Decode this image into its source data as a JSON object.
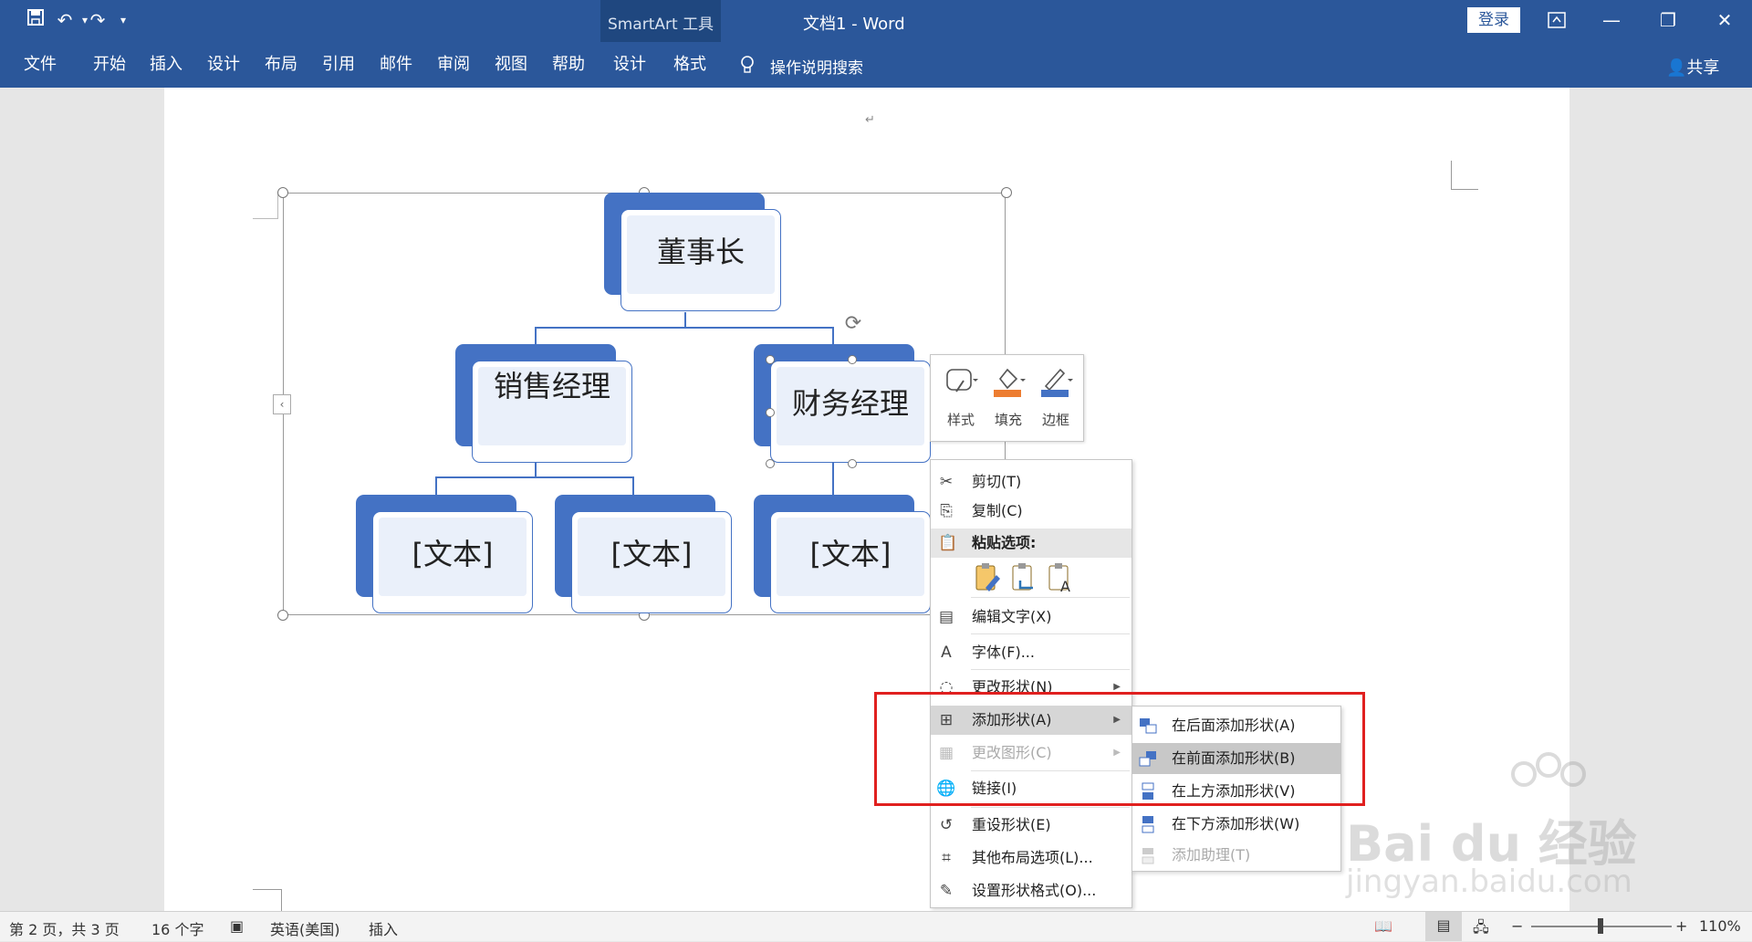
{
  "titlebar": {
    "context_tools": "SmartArt 工具",
    "doc_title": "文档1  -  Word",
    "login": "登录",
    "qat": {
      "save": "💾",
      "undo": "↶",
      "redo": "↷",
      "more": "▾"
    }
  },
  "ribbon": {
    "tabs": [
      "文件",
      "开始",
      "插入",
      "设计",
      "布局",
      "引用",
      "邮件",
      "审阅",
      "视图",
      "帮助",
      "设计",
      "格式"
    ],
    "tell_me": "操作说明搜索",
    "share": "共享"
  },
  "smartart": {
    "top": "董事长",
    "mid_left": "销售经理",
    "mid_right": "财务经理",
    "bottom": [
      "[文本]",
      "[文本]",
      "[文本]"
    ]
  },
  "mini_toolbar": {
    "style": "样式",
    "fill": "填充",
    "border": "边框"
  },
  "context_menu": {
    "cut": "剪切(T)",
    "copy": "复制(C)",
    "paste_options": "粘贴选项:",
    "edit_text": "编辑文字(X)",
    "font": "字体(F)...",
    "change_shape": "更改形状(N)",
    "add_shape": "添加形状(A)",
    "change_graphic": "更改图形(C)",
    "link": "链接(I)",
    "reset_shape": "重设形状(E)",
    "more_layout": "其他布局选项(L)...",
    "format_shape": "设置形状格式(O)..."
  },
  "submenu": {
    "add_after": "在后面添加形状(A)",
    "add_before": "在前面添加形状(B)",
    "add_above": "在上方添加形状(V)",
    "add_below": "在下方添加形状(W)",
    "add_assistant": "添加助理(T)"
  },
  "status": {
    "page": "第 2 页，共 3 页",
    "words": "16 个字",
    "lang": "英语(美国)",
    "mode": "插入",
    "zoom": "110%"
  },
  "watermark": {
    "brand": "Bai du 经验",
    "url": "jingyan.baidu.com"
  },
  "colors": {
    "accent": "#2b579a",
    "smartart": "#4472c4",
    "highlight": "#e0201f"
  }
}
